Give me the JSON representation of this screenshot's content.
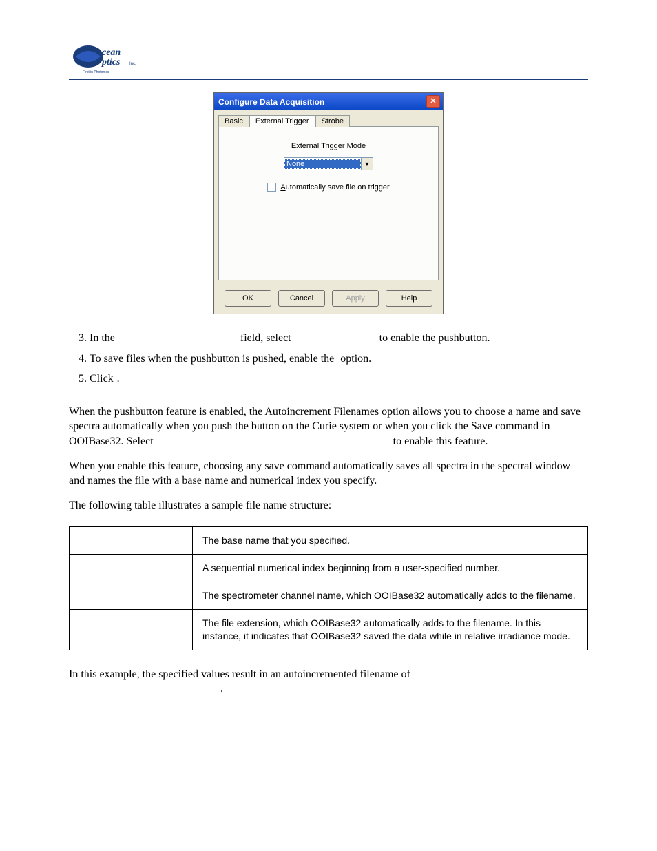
{
  "header": {
    "section_title": ""
  },
  "dialog": {
    "title": "Configure Data Acquisition",
    "tabs": [
      "Basic",
      "External Trigger",
      "Strobe"
    ],
    "active_tab_index": 1,
    "field_label": "External Trigger Mode",
    "dropdown_value": "None",
    "checkbox_label": "Automatically save file on trigger",
    "buttons": {
      "ok": "OK",
      "cancel": "Cancel",
      "apply": "Apply",
      "help": "Help"
    }
  },
  "steps": {
    "s3_a": "In the ",
    "s3_b": " field, select ",
    "s3_c": " to enable the pushbutton.",
    "s4_a": "To save files when the pushbutton is pushed, enable the ",
    "s4_b": " option.",
    "s5_a": "Click ",
    "s5_b": "."
  },
  "paragraphs": {
    "p1_a": "When the pushbutton feature is enabled, the Autoincrement Filenames option allows you to choose a name and save spectra automatically when you push the button on the Curie system or when you click the Save command in OOIBase32. Select ",
    "p1_b": " to enable this feature.",
    "p2": "When you enable this feature, choosing any save command automatically saves all spectra in the spectral window and names the file with a base name and numerical index you specify.",
    "p3": "The following table illustrates a sample file name structure:",
    "p4_a": "In this example, the specified values result in an autoincremented filename of ",
    "p4_b": "."
  },
  "table": {
    "rows": [
      {
        "key": "",
        "desc": "The base name that you specified."
      },
      {
        "key": "",
        "desc": "A sequential numerical index beginning from a user-specified number."
      },
      {
        "key": "",
        "desc": "The spectrometer channel name, which OOIBase32 automatically adds to the filename."
      },
      {
        "key": "",
        "desc": "The file extension, which OOIBase32 automatically adds to the filename. In this instance, it indicates that OOIBase32 saved the data while in relative irradiance mode."
      }
    ]
  },
  "footer": {
    "left": "",
    "right": ""
  }
}
